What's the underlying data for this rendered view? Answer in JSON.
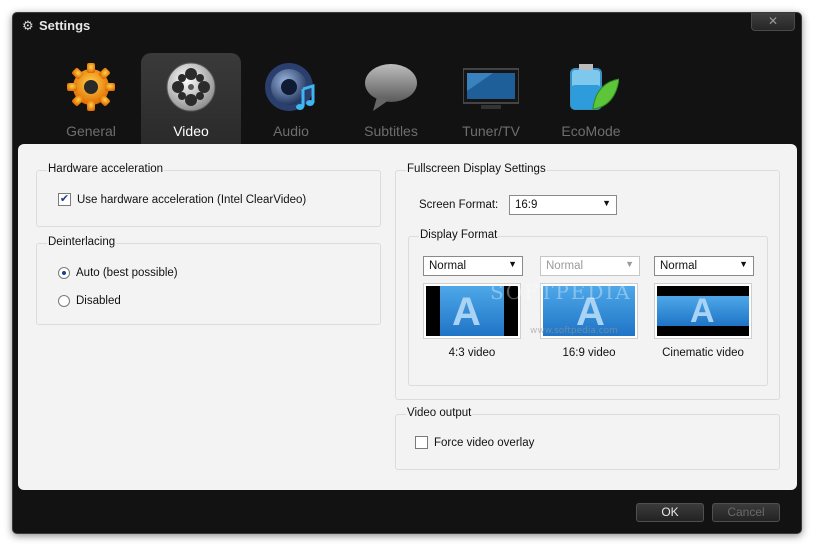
{
  "window": {
    "title": "Settings",
    "close_label": "✕"
  },
  "tabs": [
    {
      "label": "General",
      "icon": "gear-icon"
    },
    {
      "label": "Video",
      "icon": "film-reel-icon"
    },
    {
      "label": "Audio",
      "icon": "speaker-icon"
    },
    {
      "label": "Subtitles",
      "icon": "speech-bubble-icon"
    },
    {
      "label": "Tuner/TV",
      "icon": "tv-icon"
    },
    {
      "label": "EcoMode",
      "icon": "battery-leaf-icon"
    }
  ],
  "active_tab": "Video",
  "hardware": {
    "title": "Hardware acceleration",
    "checkbox_label": "Use hardware acceleration (Intel ClearVideo)",
    "checked": true
  },
  "deinterlacing": {
    "title": "Deinterlacing",
    "options": [
      "Auto (best possible)",
      "Disabled"
    ],
    "selected": "Auto (best possible)"
  },
  "fullscreen": {
    "title": "Fullscreen Display Settings",
    "screen_format_label": "Screen Format:",
    "screen_format_value": "16:9",
    "display_format_title": "Display Format",
    "formats": [
      {
        "value": "Normal",
        "caption": "4:3 video",
        "enabled": true
      },
      {
        "value": "Normal",
        "caption": "16:9 video",
        "enabled": false
      },
      {
        "value": "Normal",
        "caption": "Cinematic video",
        "enabled": true
      }
    ],
    "watermark": "SOFTPEDIA",
    "watermark_sub": "www.softpedia.com"
  },
  "video_output": {
    "title": "Video output",
    "checkbox_label": "Force video overlay",
    "checked": false
  },
  "footer": {
    "ok_label": "OK",
    "cancel_label": "Cancel"
  },
  "colors": {
    "chrome": "#121212",
    "panel": "#f3f3f3",
    "accent": "#1f74c6"
  }
}
